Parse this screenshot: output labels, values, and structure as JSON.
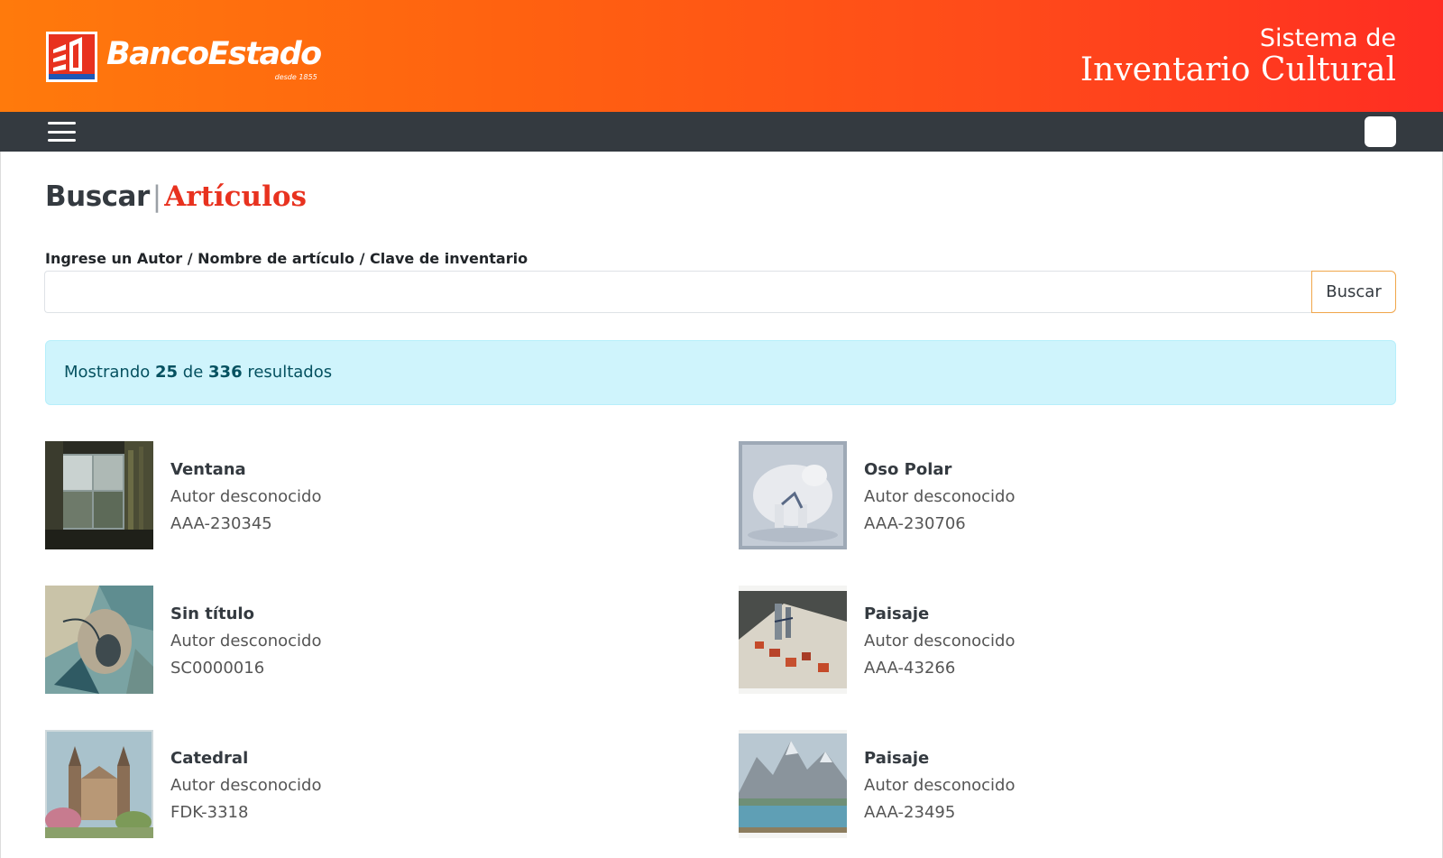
{
  "header": {
    "brand_name": "BancoEstado",
    "brand_tagline": "desde 1855",
    "system_title_line1": "Sistema de",
    "system_title_line2": "Inventario Cultural"
  },
  "page": {
    "title_part1": "Buscar",
    "title_part2": "Artículos"
  },
  "search": {
    "label": "Ingrese un Autor / Nombre de artículo / Clave de inventario",
    "value": "",
    "button_label": "Buscar"
  },
  "results_info": {
    "prefix": "Mostrando",
    "shown": "25",
    "middle": "de",
    "total": "336",
    "suffix": "resultados"
  },
  "results": [
    {
      "title": "Ventana",
      "author": "Autor desconocido",
      "code": "AAA-230345"
    },
    {
      "title": "Oso Polar",
      "author": "Autor desconocido",
      "code": "AAA-230706"
    },
    {
      "title": "Sin título",
      "author": "Autor desconocido",
      "code": "SC0000016"
    },
    {
      "title": "Paisaje",
      "author": "Autor desconocido",
      "code": "AAA-43266"
    },
    {
      "title": "Catedral",
      "author": "Autor desconocido",
      "code": "FDK-3318"
    },
    {
      "title": "Paisaje",
      "author": "Autor desconocido",
      "code": "AAA-23495"
    }
  ],
  "colors": {
    "header_gradient_start": "#ff7a0c",
    "header_gradient_end": "#ff2d22",
    "navbar": "#343a40",
    "title_accent": "#e8321f",
    "alert_bg": "#cff4fc",
    "alert_text": "#055160",
    "search_button_border": "#f0a64a"
  }
}
